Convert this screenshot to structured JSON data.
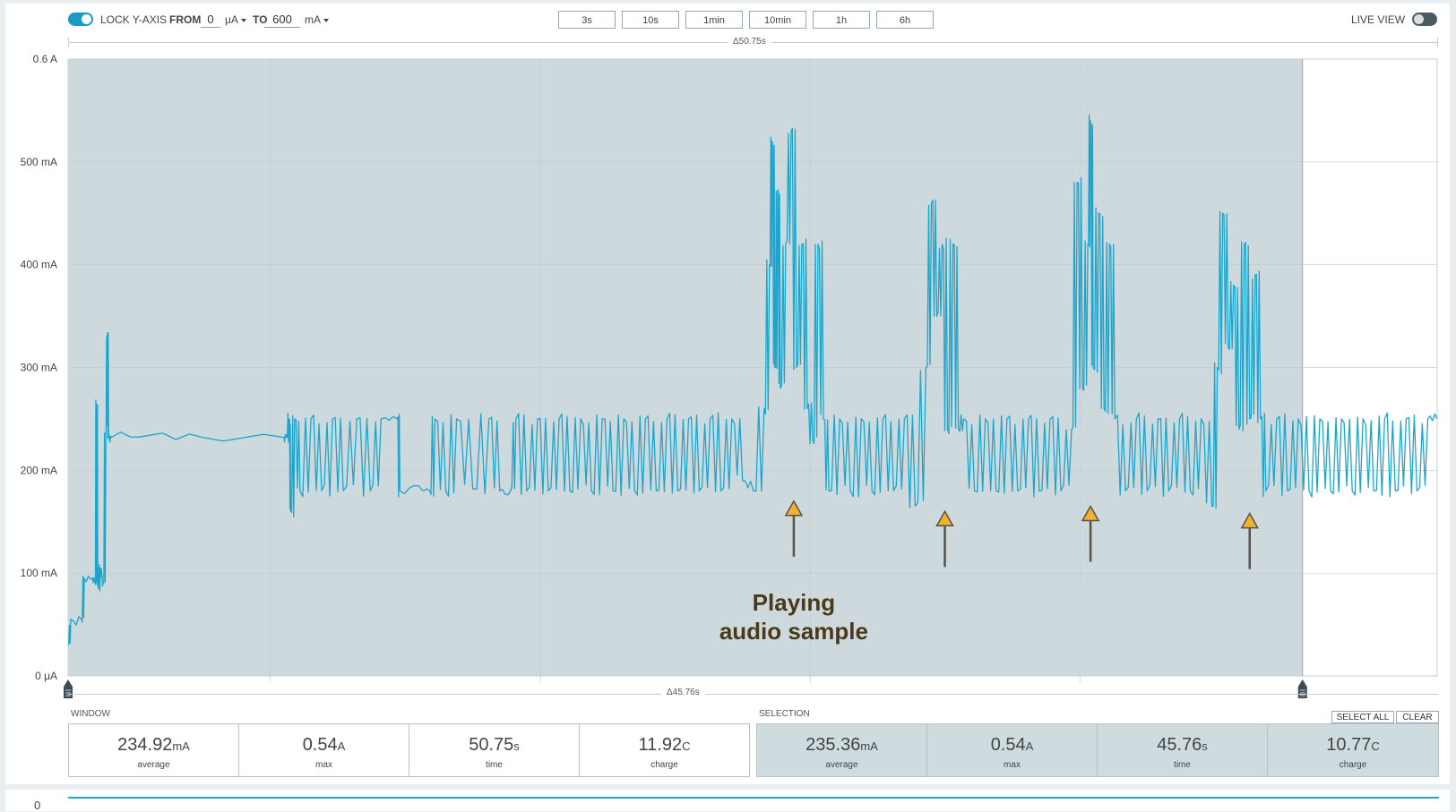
{
  "toolbar": {
    "lock_label": "LOCK Y-AXIS",
    "from_label": "FROM",
    "from_value": "0",
    "from_unit": "μA",
    "to_label": "TO",
    "to_value": "600",
    "to_unit": "mA",
    "window_buttons": [
      "3s",
      "10s",
      "1min",
      "10min",
      "1h",
      "6h"
    ],
    "live_view_label": "LIVE VIEW",
    "lock_enabled": true,
    "live_view_enabled": false
  },
  "top_span": {
    "label": "Δ50.75s"
  },
  "selection_span": {
    "label": "Δ45.76s"
  },
  "annotation": {
    "line1": "Playing",
    "line2": "audio sample",
    "arrow_count": 4
  },
  "window": {
    "title": "WINDOW",
    "stats": [
      {
        "value": "234.92",
        "unit": "mA",
        "caption": "average"
      },
      {
        "value": "0.54",
        "unit": "A",
        "caption": "max"
      },
      {
        "value": "50.75",
        "unit": "s",
        "caption": "time"
      },
      {
        "value": "11.92",
        "unit": "C",
        "caption": "charge"
      }
    ]
  },
  "selection": {
    "title": "SELECTION",
    "select_all": "SELECT ALL",
    "clear": "CLEAR",
    "stats": [
      {
        "value": "235.36",
        "unit": "mA",
        "caption": "average"
      },
      {
        "value": "0.54",
        "unit": "A",
        "caption": "max"
      },
      {
        "value": "45.76",
        "unit": "s",
        "caption": "time"
      },
      {
        "value": "10.77",
        "unit": "C",
        "caption": "charge"
      }
    ]
  },
  "bottom_chart": {
    "axis_label": "0"
  },
  "colors": {
    "accent": "#1fa5cc",
    "selection": "#cdd9dc",
    "annotation": "#4a3a1a",
    "arrow_fill": "#f0b030"
  },
  "chart_data": {
    "type": "line",
    "title": "",
    "xlabel": "",
    "ylabel": "",
    "y_unit": "mA",
    "ylim": [
      0,
      600
    ],
    "y_ticks": [
      "0 μA",
      "100 mA",
      "200 mA",
      "300 mA",
      "400 mA",
      "500 mA",
      "0.6 A"
    ],
    "x_range_s": [
      0,
      50.75
    ],
    "selection_range_s": [
      0,
      45.76
    ],
    "grid": true,
    "series": [
      {
        "values": [
          [
            0.0,
            30
          ],
          [
            0.1,
            55
          ],
          [
            0.5,
            55
          ],
          [
            0.6,
            95
          ],
          [
            0.9,
            95
          ],
          [
            1.0,
            90
          ],
          [
            1.05,
            265
          ],
          [
            1.1,
            88
          ],
          [
            1.2,
            105
          ],
          [
            1.25,
            95
          ],
          [
            1.3,
            90
          ],
          [
            1.4,
            240
          ],
          [
            1.45,
            330
          ],
          [
            1.5,
            232
          ],
          [
            1.6,
            232
          ],
          [
            3.0,
            234
          ],
          [
            5.0,
            232
          ],
          [
            8.0,
            232
          ],
          [
            8.1,
            232
          ],
          [
            8.2,
            250
          ],
          [
            8.25,
            160
          ],
          [
            8.4,
            250
          ],
          [
            8.6,
            180
          ],
          [
            9.0,
            250
          ],
          [
            9.4,
            180
          ],
          [
            9.8,
            250
          ],
          [
            10.2,
            180
          ],
          [
            10.7,
            250
          ],
          [
            11.2,
            180
          ],
          [
            11.6,
            250
          ],
          [
            12.2,
            250
          ],
          [
            12.3,
            180
          ],
          [
            13.0,
            185
          ],
          [
            13.4,
            180
          ],
          [
            13.6,
            250
          ],
          [
            14.0,
            180
          ],
          [
            14.4,
            250
          ],
          [
            15.0,
            182
          ],
          [
            15.6,
            250
          ],
          [
            16.0,
            180
          ],
          [
            16.4,
            180
          ],
          [
            16.6,
            250
          ],
          [
            17.0,
            180
          ],
          [
            17.4,
            250
          ],
          [
            17.8,
            180
          ],
          [
            18.2,
            250
          ],
          [
            18.6,
            180
          ],
          [
            19.0,
            250
          ],
          [
            19.4,
            180
          ],
          [
            19.8,
            250
          ],
          [
            20.2,
            180
          ],
          [
            20.6,
            250
          ],
          [
            21.0,
            180
          ],
          [
            21.4,
            250
          ],
          [
            21.8,
            180
          ],
          [
            22.2,
            250
          ],
          [
            22.6,
            180
          ],
          [
            23.0,
            250
          ],
          [
            23.4,
            180
          ],
          [
            23.8,
            250
          ],
          [
            24.2,
            180
          ],
          [
            24.6,
            250
          ],
          [
            25.0,
            190
          ],
          [
            25.4,
            180
          ],
          [
            25.8,
            260
          ],
          [
            26.0,
            400
          ],
          [
            26.1,
            520
          ],
          [
            26.2,
            300
          ],
          [
            26.3,
            470
          ],
          [
            26.4,
            280
          ],
          [
            26.6,
            420
          ],
          [
            26.8,
            530
          ],
          [
            27.0,
            300
          ],
          [
            27.2,
            420
          ],
          [
            27.4,
            260
          ],
          [
            27.6,
            230
          ],
          [
            27.8,
            420
          ],
          [
            28.0,
            250
          ],
          [
            28.2,
            180
          ],
          [
            28.6,
            250
          ],
          [
            29.0,
            180
          ],
          [
            29.4,
            250
          ],
          [
            29.8,
            180
          ],
          [
            30.2,
            250
          ],
          [
            30.6,
            180
          ],
          [
            31.0,
            250
          ],
          [
            31.4,
            165
          ],
          [
            31.8,
            300
          ],
          [
            32.0,
            460
          ],
          [
            32.2,
            350
          ],
          [
            32.4,
            420
          ],
          [
            32.6,
            240
          ],
          [
            32.8,
            420
          ],
          [
            33.0,
            240
          ],
          [
            33.2,
            250
          ],
          [
            33.6,
            180
          ],
          [
            34.0,
            250
          ],
          [
            34.4,
            180
          ],
          [
            34.8,
            250
          ],
          [
            35.2,
            180
          ],
          [
            35.6,
            250
          ],
          [
            36.0,
            180
          ],
          [
            36.4,
            250
          ],
          [
            36.8,
            180
          ],
          [
            37.2,
            240
          ],
          [
            37.4,
            480
          ],
          [
            37.6,
            280
          ],
          [
            37.8,
            420
          ],
          [
            37.9,
            540
          ],
          [
            38.0,
            300
          ],
          [
            38.2,
            450
          ],
          [
            38.4,
            260
          ],
          [
            38.6,
            420
          ],
          [
            38.8,
            250
          ],
          [
            39.2,
            180
          ],
          [
            39.6,
            250
          ],
          [
            40.0,
            180
          ],
          [
            40.4,
            250
          ],
          [
            40.8,
            180
          ],
          [
            41.2,
            250
          ],
          [
            41.6,
            180
          ],
          [
            42.0,
            250
          ],
          [
            42.4,
            165
          ],
          [
            42.6,
            300
          ],
          [
            42.8,
            450
          ],
          [
            43.0,
            320
          ],
          [
            43.2,
            380
          ],
          [
            43.4,
            240
          ],
          [
            43.6,
            420
          ],
          [
            43.8,
            250
          ],
          [
            44.0,
            390
          ],
          [
            44.2,
            250
          ],
          [
            44.4,
            180
          ],
          [
            44.8,
            250
          ],
          [
            45.2,
            180
          ],
          [
            45.6,
            250
          ],
          [
            46.0,
            180
          ],
          [
            46.4,
            250
          ],
          [
            46.8,
            180
          ],
          [
            47.2,
            250
          ],
          [
            47.6,
            180
          ],
          [
            48.0,
            250
          ],
          [
            48.4,
            180
          ],
          [
            48.8,
            250
          ],
          [
            49.2,
            180
          ],
          [
            49.6,
            250
          ],
          [
            50.0,
            180
          ],
          [
            50.4,
            250
          ],
          [
            50.75,
            250
          ]
        ]
      }
    ],
    "annotations": [
      {
        "text": "Playing audio sample",
        "x_s": 26.9,
        "y": 60
      },
      {
        "arrow_x_s": 26.9,
        "arrow_tip_y": 170
      },
      {
        "arrow_x_s": 32.5,
        "arrow_tip_y": 160
      },
      {
        "arrow_x_s": 37.9,
        "arrow_tip_y": 165
      },
      {
        "arrow_x_s": 43.8,
        "arrow_tip_y": 158
      }
    ]
  }
}
